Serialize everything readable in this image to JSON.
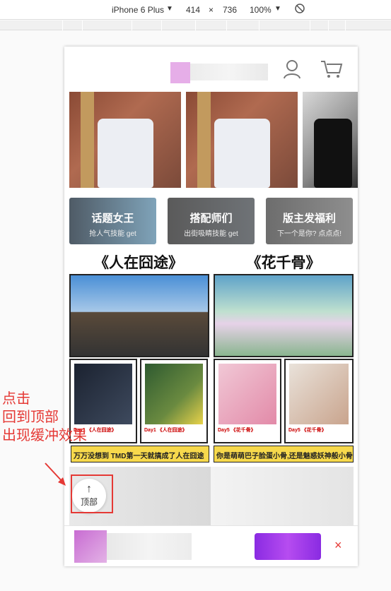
{
  "devtools": {
    "device": "iPhone 6 Plus",
    "width": "414",
    "times": "×",
    "height": "736",
    "zoom": "100%"
  },
  "categories": [
    {
      "title": "话题女王",
      "subtitle": "抢人气技能 get"
    },
    {
      "title": "搭配师们",
      "subtitle": "出街吸睛技能 get"
    },
    {
      "title": "版主发福利",
      "subtitle": "下一个是你? 点点点!"
    }
  ],
  "sections": {
    "left_title": "《人在囧途》",
    "right_title": "《花千骨》"
  },
  "frames": [
    "Day1 《人在囧途》",
    "Day1 《人在囧途》",
    "Day5 《花千骨》",
    "Day5 《花千骨》"
  ],
  "strip": {
    "left": "万万没想到 TMD第一天就搞成了人在囧途",
    "right": "你是萌萌巴子脸蛋小骨,还是魅惑妖神般小骨?"
  },
  "back_to_top": {
    "arrow": "↑",
    "label": "顶部"
  },
  "annotation": {
    "line1": "点击",
    "line2": "回到顶部",
    "line3": "出现缓冲效果"
  },
  "download_bar": {
    "close": "×"
  },
  "colors": {
    "accent": "#e53935",
    "button": "#b64cf0",
    "strip": "#f7d94c"
  }
}
